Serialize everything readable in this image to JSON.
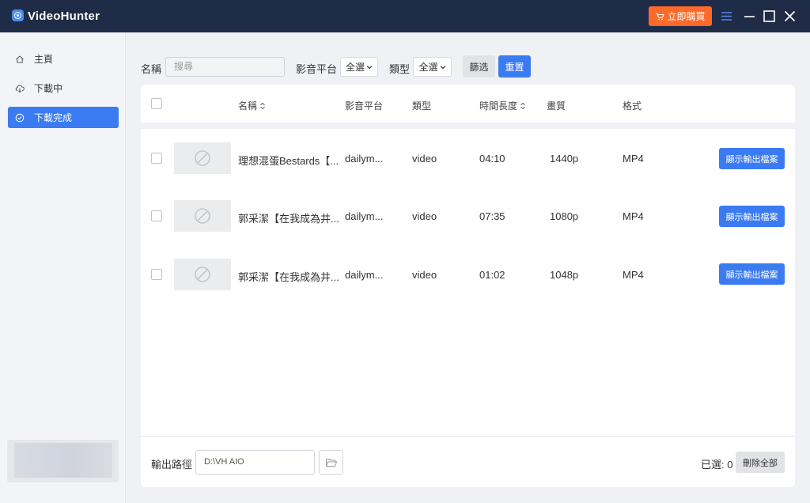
{
  "app": {
    "title": "VideoHunter",
    "buy_label": "立即購買",
    "accent": "#3a7bf1",
    "buy_color": "#ff6a2b",
    "titlebar_color": "#1f2c47"
  },
  "sidebar": {
    "items": [
      {
        "label": "主頁",
        "icon": "home-icon"
      },
      {
        "label": "下載中",
        "icon": "cloud-download-icon"
      },
      {
        "label": "下載完成",
        "icon": "check-circle-icon",
        "active": true
      }
    ]
  },
  "filter": {
    "name_label": "名稱",
    "search_placeholder": "搜尋",
    "platform_label": "影音平台",
    "platform_value": "全選",
    "type_label": "類型",
    "type_value": "全選",
    "filter_button": "篩选",
    "reset_button": "重置"
  },
  "table": {
    "headers": [
      "名稱",
      "影音平台",
      "類型",
      "時間長度",
      "畫質",
      "格式"
    ],
    "rows": [
      {
        "name": "理想混蛋Bestards【...",
        "platform": "dailym...",
        "type": "video",
        "duration": "04:10",
        "quality": "1440p",
        "format": "MP4",
        "action": "顯示輸出檔案"
      },
      {
        "name": "郭采潔【在我成為井...",
        "platform": "dailym...",
        "type": "video",
        "duration": "07:35",
        "quality": "1080p",
        "format": "MP4",
        "action": "顯示輸出檔案"
      },
      {
        "name": "郭采潔【在我成為井...",
        "platform": "dailym...",
        "type": "video",
        "duration": "01:02",
        "quality": "1048p",
        "format": "MP4",
        "action": "顯示輸出檔案"
      }
    ]
  },
  "footer": {
    "output_label": "輸出路徑",
    "output_path": "D:\\VH AIO",
    "selected_text": "已選: 0",
    "delete_all": "刪除全部"
  }
}
